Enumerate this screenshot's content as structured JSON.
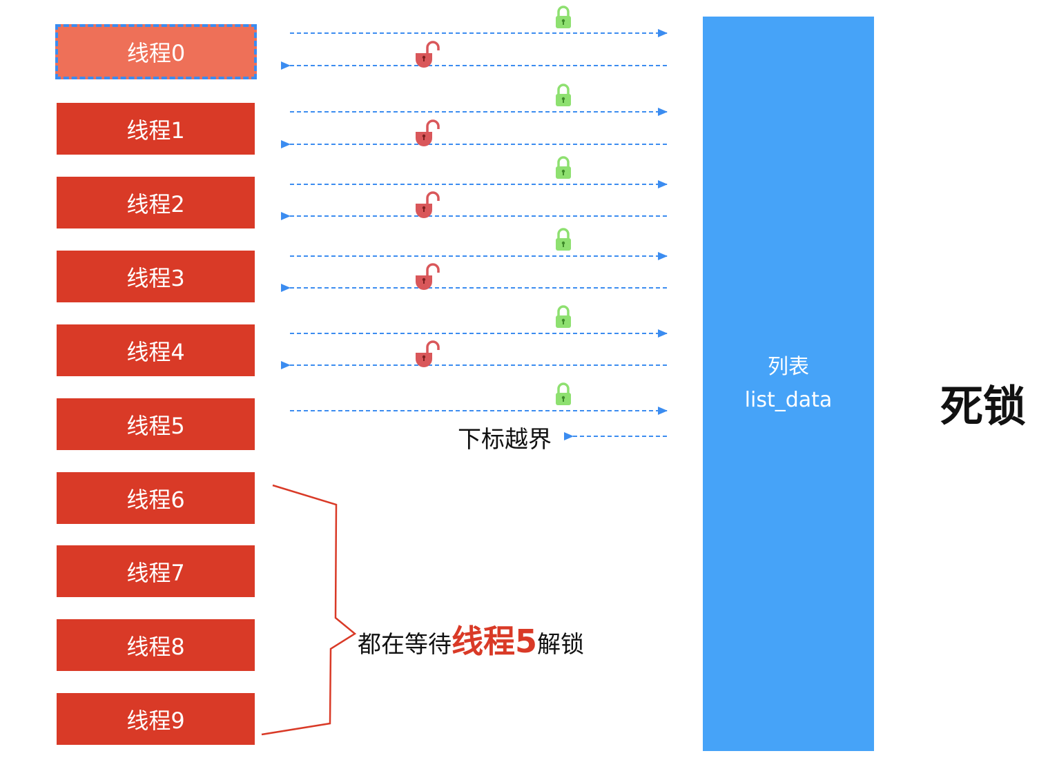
{
  "threads": [
    "线程0",
    "线程1",
    "线程2",
    "线程3",
    "线程4",
    "线程5",
    "线程6",
    "线程7",
    "线程8",
    "线程9"
  ],
  "list": {
    "title": "列表",
    "name": "list_data"
  },
  "deadlock_label": "死锁",
  "out_of_bounds_label": "下标越界",
  "waiting_note": {
    "prefix": "都在等待",
    "highlight": "线程5",
    "suffix": "解锁"
  },
  "colors": {
    "thread": "#d93a27",
    "thread_active": "#ee7058",
    "list": "#46a3f8",
    "arrow": "#3b8cf0",
    "lock_closed": "#8ee070",
    "lock_open": "#d9575a",
    "brace": "#d93a27"
  },
  "icons": [
    "lock-closed-icon",
    "lock-open-icon"
  ]
}
